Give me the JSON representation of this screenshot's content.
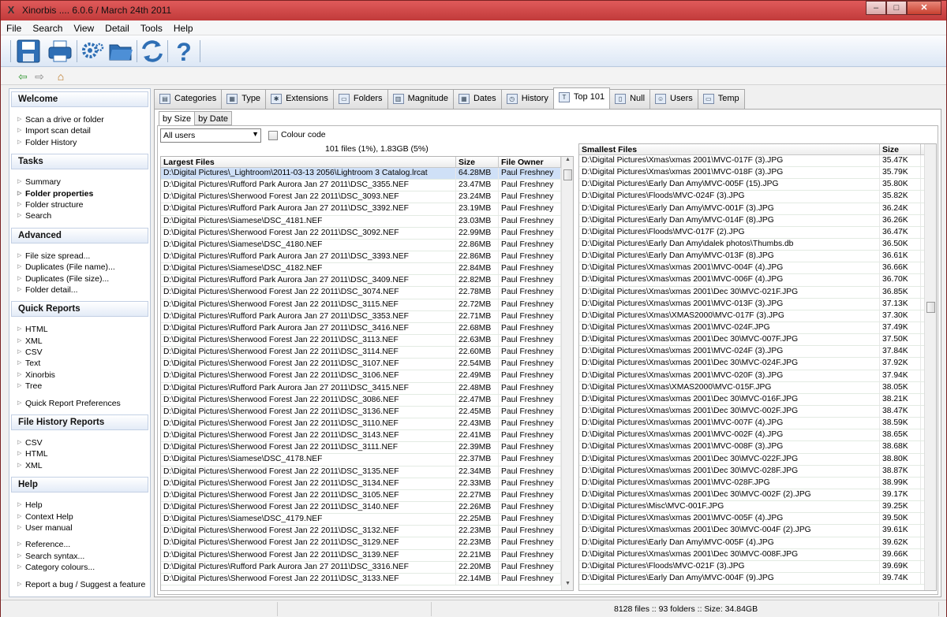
{
  "window": {
    "title": "Xinorbis .... 6.0.6 / March 24th 2011",
    "app_icon": "X",
    "minimize": "–",
    "maximize": "□",
    "close": "✕"
  },
  "menu": [
    "File",
    "Search",
    "View",
    "Detail",
    "Tools",
    "Help"
  ],
  "toolbar": {
    "icons": [
      "save-icon",
      "print-icon",
      "settings-icon",
      "open-folder-icon",
      "refresh-icon",
      "help-icon"
    ]
  },
  "nav": {
    "back": "⇦",
    "forward": "⇨",
    "home": "⌂"
  },
  "sidebar": {
    "welcome": {
      "title": "Welcome",
      "items": [
        "Scan a drive or folder",
        "Import scan detail",
        "Folder History"
      ]
    },
    "tasks": {
      "title": "Tasks",
      "items": [
        "Summary",
        "Folder properties",
        "Folder structure",
        "Search"
      ]
    },
    "advanced": {
      "title": "Advanced",
      "items": [
        "File size spread...",
        "Duplicates (File name)...",
        "Duplicates (File size)...",
        "Folder detail..."
      ]
    },
    "quick_reports": {
      "title": "Quick Reports",
      "items": [
        "HTML",
        "XML",
        "CSV",
        "Text",
        "Xinorbis",
        "Tree"
      ],
      "extra": "Quick Report Preferences"
    },
    "file_history": {
      "title": "File History Reports",
      "items": [
        "CSV",
        "HTML",
        "XML"
      ]
    },
    "help": {
      "title": "Help",
      "items": [
        "Help",
        "Context Help",
        "User manual"
      ],
      "items2": [
        "Reference...",
        "Search syntax...",
        "Category colours..."
      ],
      "extra": "Report a bug / Suggest a feature"
    }
  },
  "tabs": [
    "Categories",
    "Type",
    "Extensions",
    "Folders",
    "Magnitude",
    "Dates",
    "History",
    "Top 101",
    "Null",
    "Users",
    "Temp"
  ],
  "tab_icons": [
    "▤",
    "▦",
    "✱",
    "▭",
    "▥",
    "▦",
    "◷",
    "T",
    "▯",
    "☺",
    "▭"
  ],
  "subtabs": [
    "by Size",
    "by Date"
  ],
  "filter": {
    "user_select": "All users",
    "colour_code": "Colour code"
  },
  "summary": "101 files (1%), 1.83GB (5%)",
  "largest": {
    "headers": [
      "Largest Files",
      "Size",
      "File Owner"
    ],
    "rows": [
      [
        "D:\\Digital Pictures\\_Lightroom\\2011-03-13 2056\\Lightroom 3 Catalog.lrcat",
        "64.28MB",
        "Paul Freshney"
      ],
      [
        "D:\\Digital Pictures\\Rufford Park Aurora Jan 27 2011\\DSC_3355.NEF",
        "23.47MB",
        "Paul Freshney"
      ],
      [
        "D:\\Digital Pictures\\Sherwood Forest Jan 22 2011\\DSC_3093.NEF",
        "23.24MB",
        "Paul Freshney"
      ],
      [
        "D:\\Digital Pictures\\Rufford Park Aurora Jan 27 2011\\DSC_3392.NEF",
        "23.19MB",
        "Paul Freshney"
      ],
      [
        "D:\\Digital Pictures\\Siamese\\DSC_4181.NEF",
        "23.03MB",
        "Paul Freshney"
      ],
      [
        "D:\\Digital Pictures\\Sherwood Forest Jan 22 2011\\DSC_3092.NEF",
        "22.99MB",
        "Paul Freshney"
      ],
      [
        "D:\\Digital Pictures\\Siamese\\DSC_4180.NEF",
        "22.86MB",
        "Paul Freshney"
      ],
      [
        "D:\\Digital Pictures\\Rufford Park Aurora Jan 27 2011\\DSC_3393.NEF",
        "22.86MB",
        "Paul Freshney"
      ],
      [
        "D:\\Digital Pictures\\Siamese\\DSC_4182.NEF",
        "22.84MB",
        "Paul Freshney"
      ],
      [
        "D:\\Digital Pictures\\Rufford Park Aurora Jan 27 2011\\DSC_3409.NEF",
        "22.82MB",
        "Paul Freshney"
      ],
      [
        "D:\\Digital Pictures\\Sherwood Forest Jan 22 2011\\DSC_3074.NEF",
        "22.78MB",
        "Paul Freshney"
      ],
      [
        "D:\\Digital Pictures\\Sherwood Forest Jan 22 2011\\DSC_3115.NEF",
        "22.72MB",
        "Paul Freshney"
      ],
      [
        "D:\\Digital Pictures\\Rufford Park Aurora Jan 27 2011\\DSC_3353.NEF",
        "22.71MB",
        "Paul Freshney"
      ],
      [
        "D:\\Digital Pictures\\Rufford Park Aurora Jan 27 2011\\DSC_3416.NEF",
        "22.68MB",
        "Paul Freshney"
      ],
      [
        "D:\\Digital Pictures\\Sherwood Forest Jan 22 2011\\DSC_3113.NEF",
        "22.63MB",
        "Paul Freshney"
      ],
      [
        "D:\\Digital Pictures\\Sherwood Forest Jan 22 2011\\DSC_3114.NEF",
        "22.60MB",
        "Paul Freshney"
      ],
      [
        "D:\\Digital Pictures\\Sherwood Forest Jan 22 2011\\DSC_3107.NEF",
        "22.54MB",
        "Paul Freshney"
      ],
      [
        "D:\\Digital Pictures\\Sherwood Forest Jan 22 2011\\DSC_3106.NEF",
        "22.49MB",
        "Paul Freshney"
      ],
      [
        "D:\\Digital Pictures\\Rufford Park Aurora Jan 27 2011\\DSC_3415.NEF",
        "22.48MB",
        "Paul Freshney"
      ],
      [
        "D:\\Digital Pictures\\Sherwood Forest Jan 22 2011\\DSC_3086.NEF",
        "22.47MB",
        "Paul Freshney"
      ],
      [
        "D:\\Digital Pictures\\Sherwood Forest Jan 22 2011\\DSC_3136.NEF",
        "22.45MB",
        "Paul Freshney"
      ],
      [
        "D:\\Digital Pictures\\Sherwood Forest Jan 22 2011\\DSC_3110.NEF",
        "22.43MB",
        "Paul Freshney"
      ],
      [
        "D:\\Digital Pictures\\Sherwood Forest Jan 22 2011\\DSC_3143.NEF",
        "22.41MB",
        "Paul Freshney"
      ],
      [
        "D:\\Digital Pictures\\Sherwood Forest Jan 22 2011\\DSC_3111.NEF",
        "22.39MB",
        "Paul Freshney"
      ],
      [
        "D:\\Digital Pictures\\Siamese\\DSC_4178.NEF",
        "22.37MB",
        "Paul Freshney"
      ],
      [
        "D:\\Digital Pictures\\Sherwood Forest Jan 22 2011\\DSC_3135.NEF",
        "22.34MB",
        "Paul Freshney"
      ],
      [
        "D:\\Digital Pictures\\Sherwood Forest Jan 22 2011\\DSC_3134.NEF",
        "22.33MB",
        "Paul Freshney"
      ],
      [
        "D:\\Digital Pictures\\Sherwood Forest Jan 22 2011\\DSC_3105.NEF",
        "22.27MB",
        "Paul Freshney"
      ],
      [
        "D:\\Digital Pictures\\Sherwood Forest Jan 22 2011\\DSC_3140.NEF",
        "22.26MB",
        "Paul Freshney"
      ],
      [
        "D:\\Digital Pictures\\Siamese\\DSC_4179.NEF",
        "22.25MB",
        "Paul Freshney"
      ],
      [
        "D:\\Digital Pictures\\Sherwood Forest Jan 22 2011\\DSC_3132.NEF",
        "22.23MB",
        "Paul Freshney"
      ],
      [
        "D:\\Digital Pictures\\Sherwood Forest Jan 22 2011\\DSC_3129.NEF",
        "22.23MB",
        "Paul Freshney"
      ],
      [
        "D:\\Digital Pictures\\Sherwood Forest Jan 22 2011\\DSC_3139.NEF",
        "22.21MB",
        "Paul Freshney"
      ],
      [
        "D:\\Digital Pictures\\Rufford Park Aurora Jan 27 2011\\DSC_3316.NEF",
        "22.20MB",
        "Paul Freshney"
      ],
      [
        "D:\\Digital Pictures\\Sherwood Forest Jan 22 2011\\DSC_3133.NEF",
        "22.14MB",
        "Paul Freshney"
      ]
    ]
  },
  "smallest": {
    "headers": [
      "Smallest Files",
      "Size"
    ],
    "rows": [
      [
        "D:\\Digital Pictures\\Xmas\\xmas 2001\\MVC-017F (3).JPG",
        "35.47K"
      ],
      [
        "D:\\Digital Pictures\\Xmas\\xmas 2001\\MVC-018F (3).JPG",
        "35.79K"
      ],
      [
        "D:\\Digital Pictures\\Early Dan Amy\\MVC-005F (15).JPG",
        "35.80K"
      ],
      [
        "D:\\Digital Pictures\\Floods\\MVC-024F (3).JPG",
        "35.82K"
      ],
      [
        "D:\\Digital Pictures\\Early Dan Amy\\MVC-001F (3).JPG",
        "36.24K"
      ],
      [
        "D:\\Digital Pictures\\Early Dan Amy\\MVC-014F (8).JPG",
        "36.26K"
      ],
      [
        "D:\\Digital Pictures\\Floods\\MVC-017F (2).JPG",
        "36.47K"
      ],
      [
        "D:\\Digital Pictures\\Early Dan Amy\\dalek photos\\Thumbs.db",
        "36.50K"
      ],
      [
        "D:\\Digital Pictures\\Early Dan Amy\\MVC-013F (8).JPG",
        "36.61K"
      ],
      [
        "D:\\Digital Pictures\\Xmas\\xmas 2001\\MVC-004F (4).JPG",
        "36.66K"
      ],
      [
        "D:\\Digital Pictures\\Xmas\\xmas 2001\\MVC-006F (4).JPG",
        "36.70K"
      ],
      [
        "D:\\Digital Pictures\\Xmas\\xmas 2001\\Dec 30\\MVC-021F.JPG",
        "36.85K"
      ],
      [
        "D:\\Digital Pictures\\Xmas\\xmas 2001\\MVC-013F (3).JPG",
        "37.13K"
      ],
      [
        "D:\\Digital Pictures\\Xmas\\XMAS2000\\MVC-017F (3).JPG",
        "37.30K"
      ],
      [
        "D:\\Digital Pictures\\Xmas\\xmas 2001\\MVC-024F.JPG",
        "37.49K"
      ],
      [
        "D:\\Digital Pictures\\Xmas\\xmas 2001\\Dec 30\\MVC-007F.JPG",
        "37.50K"
      ],
      [
        "D:\\Digital Pictures\\Xmas\\xmas 2001\\MVC-024F (3).JPG",
        "37.84K"
      ],
      [
        "D:\\Digital Pictures\\Xmas\\xmas 2001\\Dec 30\\MVC-024F.JPG",
        "37.92K"
      ],
      [
        "D:\\Digital Pictures\\Xmas\\xmas 2001\\MVC-020F (3).JPG",
        "37.94K"
      ],
      [
        "D:\\Digital Pictures\\Xmas\\XMAS2000\\MVC-015F.JPG",
        "38.05K"
      ],
      [
        "D:\\Digital Pictures\\Xmas\\xmas 2001\\Dec 30\\MVC-016F.JPG",
        "38.21K"
      ],
      [
        "D:\\Digital Pictures\\Xmas\\xmas 2001\\Dec 30\\MVC-002F.JPG",
        "38.47K"
      ],
      [
        "D:\\Digital Pictures\\Xmas\\xmas 2001\\MVC-007F (4).JPG",
        "38.59K"
      ],
      [
        "D:\\Digital Pictures\\Xmas\\xmas 2001\\MVC-002F (4).JPG",
        "38.65K"
      ],
      [
        "D:\\Digital Pictures\\Xmas\\xmas 2001\\MVC-008F (3).JPG",
        "38.68K"
      ],
      [
        "D:\\Digital Pictures\\Xmas\\xmas 2001\\Dec 30\\MVC-022F.JPG",
        "38.80K"
      ],
      [
        "D:\\Digital Pictures\\Xmas\\xmas 2001\\Dec 30\\MVC-028F.JPG",
        "38.87K"
      ],
      [
        "D:\\Digital Pictures\\Xmas\\xmas 2001\\MVC-028F.JPG",
        "38.99K"
      ],
      [
        "D:\\Digital Pictures\\Xmas\\xmas 2001\\Dec 30\\MVC-002F (2).JPG",
        "39.17K"
      ],
      [
        "D:\\Digital Pictures\\Misc\\MVC-001F.JPG",
        "39.25K"
      ],
      [
        "D:\\Digital Pictures\\Xmas\\xmas 2001\\MVC-005F (4).JPG",
        "39.50K"
      ],
      [
        "D:\\Digital Pictures\\Xmas\\xmas 2001\\Dec 30\\MVC-004F (2).JPG",
        "39.61K"
      ],
      [
        "D:\\Digital Pictures\\Early Dan Amy\\MVC-005F (4).JPG",
        "39.62K"
      ],
      [
        "D:\\Digital Pictures\\Xmas\\xmas 2001\\Dec 30\\MVC-008F.JPG",
        "39.66K"
      ],
      [
        "D:\\Digital Pictures\\Floods\\MVC-021F (3).JPG",
        "39.69K"
      ],
      [
        "D:\\Digital Pictures\\Early Dan Amy\\MVC-004F (9).JPG",
        "39.74K"
      ]
    ]
  },
  "status": "8128 files  ::  93 folders  ::  Size: 34.84GB"
}
